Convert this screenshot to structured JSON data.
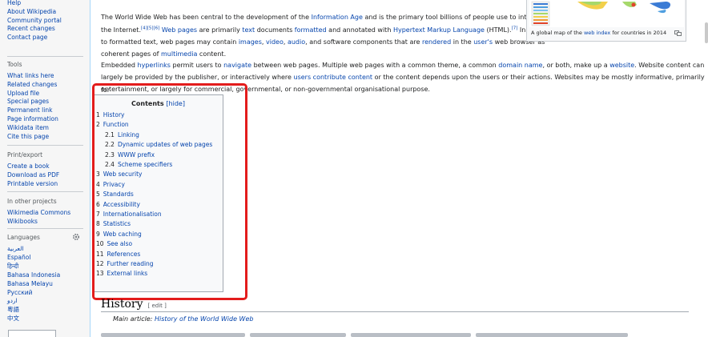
{
  "sidebar": {
    "nav_items": [
      "Help",
      "About Wikipedia",
      "Community portal",
      "Recent changes",
      "Contact page"
    ],
    "tools_heading": "Tools",
    "tools_items": [
      "What links here",
      "Related changes",
      "Upload file",
      "Special pages",
      "Permanent link",
      "Page information",
      "Wikidata item",
      "Cite this page"
    ],
    "print_heading": "Print/export",
    "print_items": [
      "Create a book",
      "Download as PDF",
      "Printable version"
    ],
    "projects_heading": "In other projects",
    "projects_items": [
      "Wikimedia Commons",
      "Wikibooks"
    ],
    "languages_heading": "Languages",
    "languages_items": [
      "العربية",
      "Español",
      "हिन्दी",
      "Bahasa Indonesia",
      "Bahasa Melayu",
      "Русский",
      "اردو",
      "粵語",
      "中文"
    ]
  },
  "content": {
    "para1": {
      "l1": [
        {
          "t": "The World Wide Web has been central to the development of the "
        },
        {
          "t": "Information Age",
          "link": true
        },
        {
          "t": " and is the primary tool billions of people use to interact on"
        }
      ],
      "l2": [
        {
          "t": "the Internet."
        },
        {
          "t": "[4][5][6]",
          "sup": true,
          "link": true
        },
        {
          "t": " "
        },
        {
          "t": "Web pages",
          "link": true
        },
        {
          "t": " are primarily "
        },
        {
          "t": "text",
          "link": true
        },
        {
          "t": " documents "
        },
        {
          "t": "formatted",
          "link": true
        },
        {
          "t": " and annotated with "
        },
        {
          "t": "Hypertext Markup Language",
          "link": true
        },
        {
          "t": " (HTML)."
        },
        {
          "t": "[7]",
          "sup": true,
          "link": true
        },
        {
          "t": " In addition"
        }
      ],
      "l3": [
        {
          "t": "to formatted text, web pages may contain "
        },
        {
          "t": "images",
          "link": true
        },
        {
          "t": ", "
        },
        {
          "t": "video",
          "link": true
        },
        {
          "t": ", "
        },
        {
          "t": "audio",
          "link": true
        },
        {
          "t": ", and software components that are "
        },
        {
          "t": "rendered",
          "link": true
        },
        {
          "t": " in the "
        },
        {
          "t": "user's",
          "link": true
        },
        {
          "t": " web browser as"
        }
      ],
      "l4": [
        {
          "t": "coherent pages of "
        },
        {
          "t": "multimedia",
          "link": true
        },
        {
          "t": " content."
        }
      ]
    },
    "para2": {
      "l1": [
        {
          "t": "Embedded "
        },
        {
          "t": "hyperlinks",
          "link": true
        },
        {
          "t": " permit users to "
        },
        {
          "t": "navigate",
          "link": true
        },
        {
          "t": " between web pages. Multiple web pages with a common theme, a common "
        },
        {
          "t": "domain name",
          "link": true
        },
        {
          "t": ", or both, make up a "
        },
        {
          "t": "website",
          "link": true
        },
        {
          "t": ". Website content can"
        }
      ],
      "l2": [
        {
          "t": "largely be provided by the publisher, or interactively where "
        },
        {
          "t": "users contribute content",
          "link": true
        },
        {
          "t": " or the content depends upon the users or their actions. Websites may be mostly informative, primarily for"
        }
      ],
      "l3": [
        {
          "t": "entertainment, or largely for commercial, governmental, or non-governmental organisational purpose."
        }
      ]
    },
    "thumb_caption_pre": "A global map of the ",
    "thumb_caption_link": "web index",
    "thumb_caption_post": " for countries in 2014"
  },
  "toc": {
    "title": "Contents",
    "hide_label": "[hide]",
    "items": [
      {
        "num": "1",
        "label": "History",
        "level": 1
      },
      {
        "num": "2",
        "label": "Function",
        "level": 1
      },
      {
        "num": "2.1",
        "label": "Linking",
        "level": 2
      },
      {
        "num": "2.2",
        "label": "Dynamic updates of web pages",
        "level": 2
      },
      {
        "num": "2.3",
        "label": "WWW prefix",
        "level": 2
      },
      {
        "num": "2.4",
        "label": "Scheme specifiers",
        "level": 2
      },
      {
        "num": "3",
        "label": "Web security",
        "level": 1
      },
      {
        "num": "4",
        "label": "Privacy",
        "level": 1
      },
      {
        "num": "5",
        "label": "Standards",
        "level": 1
      },
      {
        "num": "6",
        "label": "Accessibility",
        "level": 1
      },
      {
        "num": "7",
        "label": "Internationalisation",
        "level": 1
      },
      {
        "num": "8",
        "label": "Statistics",
        "level": 1
      },
      {
        "num": "9",
        "label": "Web caching",
        "level": 1
      },
      {
        "num": "10",
        "label": "See also",
        "level": 1
      },
      {
        "num": "11",
        "label": "References",
        "level": 1
      },
      {
        "num": "12",
        "label": "Further reading",
        "level": 1
      },
      {
        "num": "13",
        "label": "External links",
        "level": 1
      }
    ]
  },
  "history": {
    "heading": "History",
    "edit_label": "[ edit ]",
    "main_article_pre": "Main article: ",
    "main_article_link": "History of the World Wide Web"
  },
  "colors": {
    "link": "#0645ad",
    "highlight": "#e31c1c",
    "sidebar_bg": "#f6f6f6"
  }
}
